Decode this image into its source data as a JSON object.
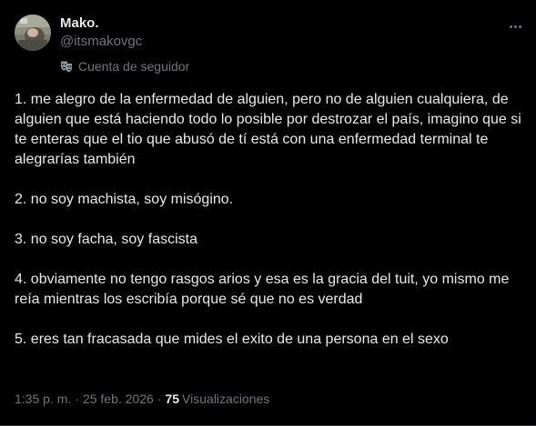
{
  "author": {
    "display_name": "Mako.",
    "handle": "@itsmakovgc",
    "label": "Cuenta de seguidor"
  },
  "icons": {
    "label_icon": "theater-masks-icon",
    "more_icon": "more-horizontal-icon"
  },
  "tweet": {
    "paragraphs": [
      "1. me alegro de la enfermedad de alguien, pero no de alguien cualquiera, de alguien que está haciendo todo lo posible por destrozar el país, imagino que si te enteras que el tio que abusó de tí está con una enfermedad terminal te alegrarías también",
      "2. no soy machista, soy misógino.",
      "3. no soy facha, soy fascista",
      "4. obviamente no tengo rasgos arios y esa es la gracia del tuit, yo mismo me reía mientras los escribía porque sé que no es verdad",
      "5. eres tan fracasada que mides el exito de una persona en el sexo"
    ]
  },
  "meta": {
    "time": "1:35 p. m.",
    "separator": "·",
    "date": "25 feb. 2026",
    "views_count": "75",
    "views_label": "Visualizaciones"
  },
  "colors": {
    "background": "#000000",
    "text_primary": "#e7e9ea",
    "text_secondary": "#71767b",
    "label_icon": "#8b98a5"
  }
}
